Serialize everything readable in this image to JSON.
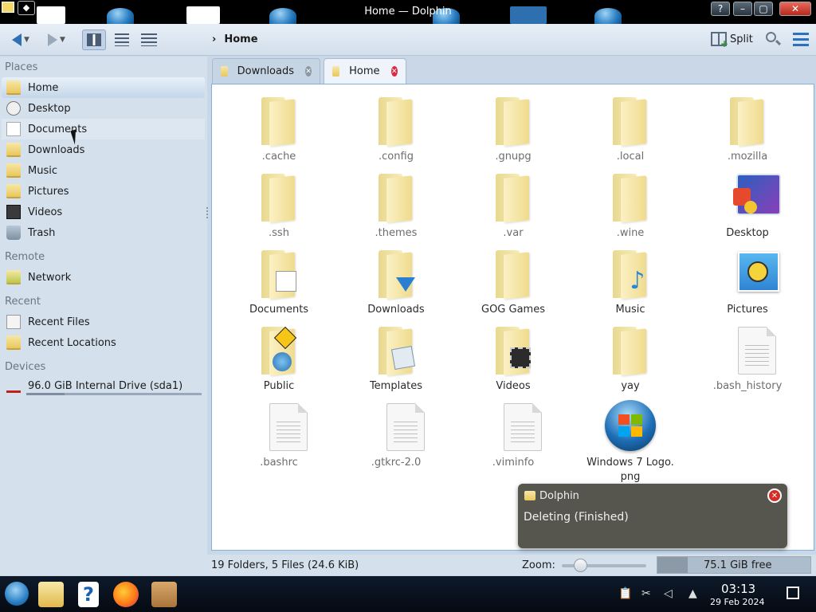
{
  "window": {
    "title": "Home — Dolphin"
  },
  "toolbar": {
    "back_icon": "back-arrow-icon",
    "forward_icon": "forward-arrow-icon",
    "breadcrumb": "Home",
    "split_label": "Split"
  },
  "sidebar": {
    "sections": {
      "places": "Places",
      "remote": "Remote",
      "recent": "Recent",
      "devices": "Devices"
    },
    "places": [
      {
        "label": "Home",
        "icon": "home-icon"
      },
      {
        "label": "Desktop",
        "icon": "desktop-icon"
      },
      {
        "label": "Documents",
        "icon": "documents-icon"
      },
      {
        "label": "Downloads",
        "icon": "downloads-icon"
      },
      {
        "label": "Music",
        "icon": "music-icon"
      },
      {
        "label": "Pictures",
        "icon": "pictures-icon"
      },
      {
        "label": "Videos",
        "icon": "videos-icon"
      },
      {
        "label": "Trash",
        "icon": "trash-icon"
      }
    ],
    "remote": [
      {
        "label": "Network",
        "icon": "network-icon"
      }
    ],
    "recent": [
      {
        "label": "Recent Files",
        "icon": "recent-files-icon"
      },
      {
        "label": "Recent Locations",
        "icon": "recent-locations-icon"
      }
    ],
    "devices": [
      {
        "label": "96.0 GiB Internal Drive (sda1)",
        "icon": "drive-icon",
        "usage_fraction": 0.22
      }
    ]
  },
  "tabs": [
    {
      "label": "Downloads",
      "active": false
    },
    {
      "label": "Home",
      "active": true
    }
  ],
  "files": [
    {
      "name": ".cache",
      "kind": "folder",
      "hidden": true
    },
    {
      "name": ".config",
      "kind": "folder",
      "hidden": true
    },
    {
      "name": ".gnupg",
      "kind": "folder",
      "hidden": true
    },
    {
      "name": ".local",
      "kind": "folder",
      "hidden": true
    },
    {
      "name": ".mozilla",
      "kind": "folder",
      "hidden": true
    },
    {
      "name": ".ssh",
      "kind": "folder",
      "hidden": true
    },
    {
      "name": ".themes",
      "kind": "folder",
      "hidden": true
    },
    {
      "name": ".var",
      "kind": "folder",
      "hidden": true
    },
    {
      "name": ".wine",
      "kind": "folder",
      "hidden": true
    },
    {
      "name": "Desktop",
      "kind": "desktop",
      "hidden": false
    },
    {
      "name": "Documents",
      "kind": "folder-documents",
      "hidden": false
    },
    {
      "name": "Downloads",
      "kind": "folder-downloads",
      "hidden": false
    },
    {
      "name": "GOG Games",
      "kind": "folder",
      "hidden": false
    },
    {
      "name": "Music",
      "kind": "folder-music",
      "hidden": false
    },
    {
      "name": "Pictures",
      "kind": "pictures",
      "hidden": false
    },
    {
      "name": "Public",
      "kind": "folder-public",
      "hidden": false
    },
    {
      "name": "Templates",
      "kind": "folder-templates",
      "hidden": false
    },
    {
      "name": "Videos",
      "kind": "folder-videos",
      "hidden": false
    },
    {
      "name": "yay",
      "kind": "folder",
      "hidden": false
    },
    {
      "name": ".bash_history",
      "kind": "text",
      "hidden": true
    },
    {
      "name": ".bashrc",
      "kind": "text",
      "hidden": true
    },
    {
      "name": ".gtkrc-2.0",
      "kind": "text",
      "hidden": true
    },
    {
      "name": ".viminfo",
      "kind": "text",
      "hidden": true
    },
    {
      "name": "Windows 7 Logo.\npng",
      "kind": "image",
      "hidden": false
    }
  ],
  "notification": {
    "app": "Dolphin",
    "message": "Deleting (Finished)"
  },
  "status": {
    "summary": "19 Folders, 5 Files (24.6 KiB)",
    "zoom_label": "Zoom:",
    "zoom_fraction": 0.25,
    "free_space": "75.1 GiB free"
  },
  "taskbar": {
    "time": "03:13",
    "date": "29 Feb 2024"
  },
  "colors": {
    "accent": "#2f6fb4",
    "close_red": "#d92b45",
    "notification_bg": "#56564f"
  }
}
